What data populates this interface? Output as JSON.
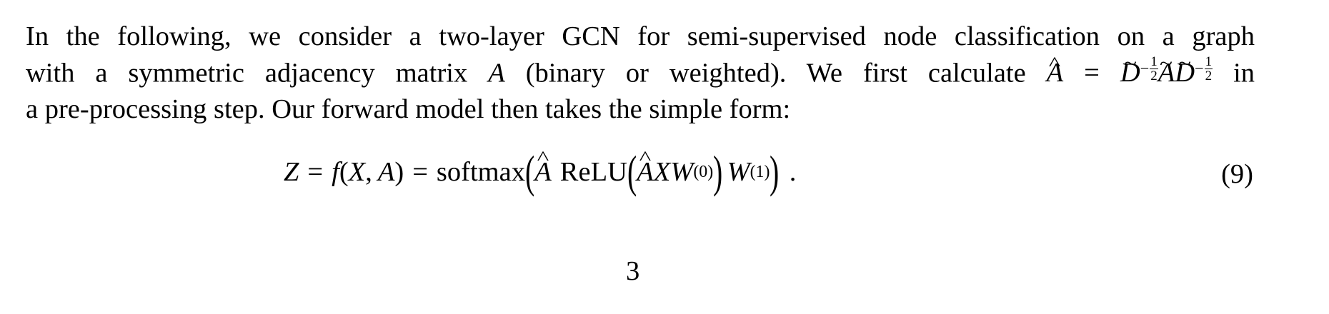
{
  "paragraph": {
    "line1": "In the following, we consider a two-layer GCN for semi-supervised node classification on a graph",
    "line2_part1": "with a symmetric adjacency matrix",
    "line2_part2": "(binary or weighted). We first calculate",
    "line2_part3": "in",
    "line3": "a pre-processing step. Our forward model then takes the simple form:"
  },
  "symbols": {
    "A": "A",
    "D": "D",
    "equals": "=",
    "minus": "−",
    "one": "1",
    "two": "2"
  },
  "equation": {
    "Z": "Z",
    "f": "f",
    "open_paren": "(",
    "X": "X",
    "comma": ",",
    "close_paren": ")",
    "softmax": "softmax",
    "relu": "ReLU",
    "W": "W",
    "sup0": "(0)",
    "sup1": "(1)",
    "period": ".",
    "number": "(9)"
  },
  "page_number": "3"
}
